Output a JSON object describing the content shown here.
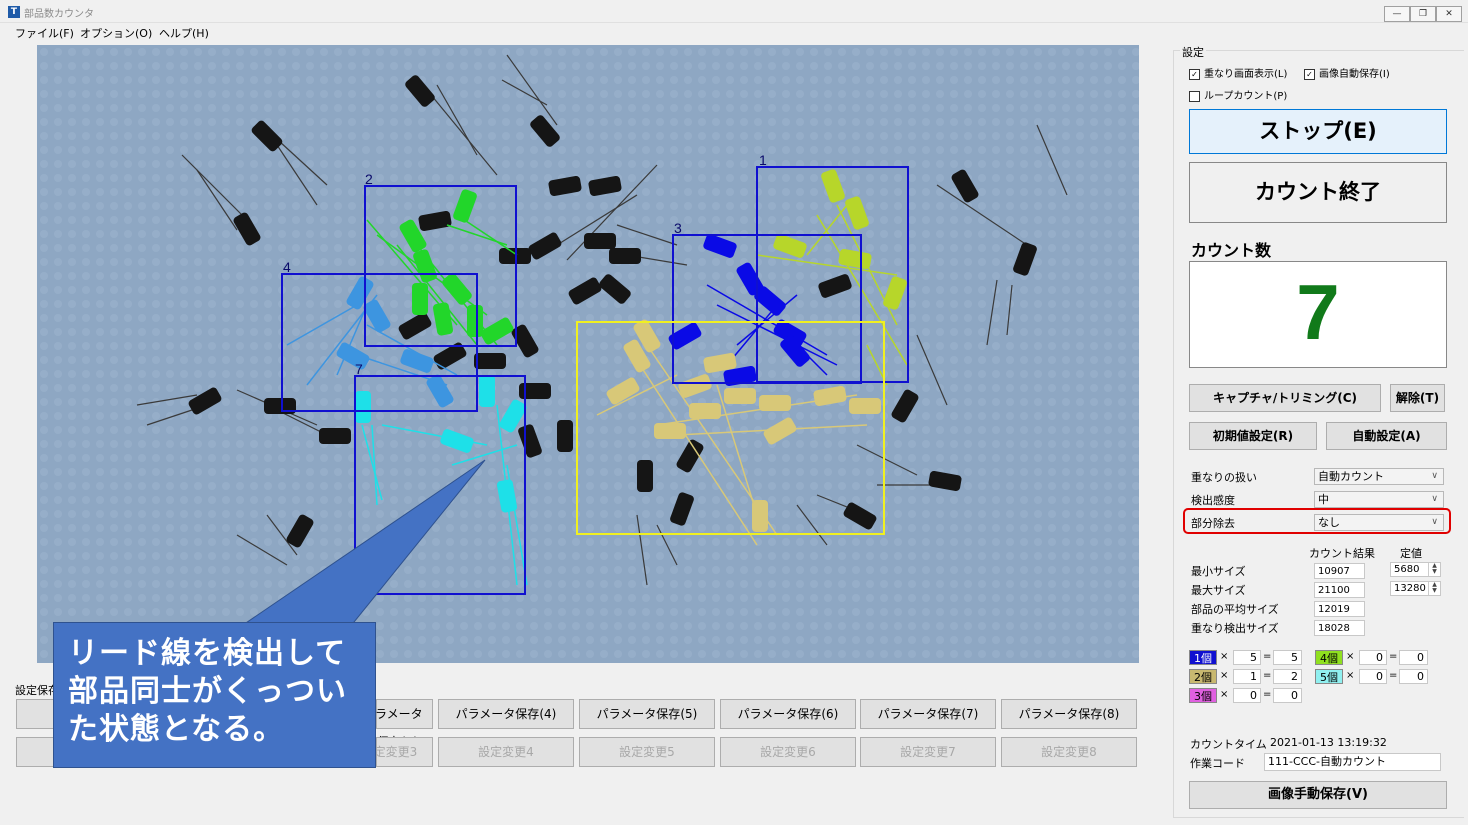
{
  "window": {
    "title": "部品数カウンタ",
    "icon_letter": "T",
    "buttons": [
      "minimize-icon",
      "restore-icon",
      "close-icon"
    ]
  },
  "menu": [
    "ファイル(F)",
    "オプション(O)",
    "ヘルプ(H)"
  ],
  "canvas": {
    "box_labels": [
      "1",
      "2",
      "3",
      "4",
      "7"
    ],
    "box_colors": {
      "1": "#1010d0",
      "2": "#1010d0",
      "3": "#1010d0",
      "4": "#1010d0",
      "7": "#1010d0",
      "yellow": "#f0f020"
    },
    "part_colors": {
      "1": "#b7d62a",
      "2": "#22d62a",
      "3": "#0a0ae6",
      "4": "#3d95e0",
      "5": "#d8c878",
      "7": "#1ee0e8"
    }
  },
  "bottom": {
    "settings_label": "設定保存",
    "save_buttons": [
      "パラメータ保存(3)",
      "パラメータ保存(4)",
      "パラメータ保存(5)",
      "パラメータ保存(6)",
      "パラメータ保存(7)",
      "パラメータ保存(8)"
    ],
    "change_buttons": [
      "設定変更3",
      "設定変更4",
      "設定変更5",
      "設定変更6",
      "設定変更7",
      "設定変更8"
    ]
  },
  "callout": {
    "lines": [
      "リード線を検出して",
      "部品同士がくっつい",
      "た状態となる。"
    ]
  },
  "panel": {
    "group_title": "設定",
    "checks": [
      {
        "label": "重なり画面表示(L)",
        "checked": true
      },
      {
        "label": "画像自動保存(I)",
        "checked": true
      },
      {
        "label": "ループカウント(P)",
        "checked": false
      }
    ],
    "stop_button": "ストップ(E)",
    "end_button": "カウント終了",
    "count_title": "カウント数",
    "count_value": "7",
    "count_color": "#117a1a",
    "capture_button": "キャプチャ/トリミング(C)",
    "release_button": "解除(T)",
    "initial_button": "初期値設定(R)",
    "auto_button": "自動設定(A)",
    "selects": [
      {
        "label": "重なりの扱い",
        "value": "自動カウント"
      },
      {
        "label": "検出感度",
        "value": "中"
      },
      {
        "label": "部分除去",
        "value": "なし"
      }
    ],
    "highlight_color": "#e00000",
    "table": {
      "headers": [
        "カウント結果",
        "定値"
      ],
      "rows": [
        {
          "label": "最小サイズ",
          "result": "10907",
          "set": "5680"
        },
        {
          "label": "最大サイズ",
          "result": "21100",
          "set": "13280"
        },
        {
          "label": "部品の平均サイズ",
          "result": "12019",
          "set": ""
        },
        {
          "label": "重なり検出サイズ",
          "result": "18028",
          "set": ""
        }
      ]
    },
    "multipliers_left": [
      {
        "tag": "1個",
        "color": "#1010d0",
        "text_color": "#ffffff",
        "qty": "5",
        "total": "5"
      },
      {
        "tag": "2個",
        "color": "#c8b870",
        "text_color": "#000000",
        "qty": "1",
        "total": "2"
      },
      {
        "tag": "3個",
        "color": "#e060e0",
        "text_color": "#000000",
        "qty": "0",
        "total": "0"
      }
    ],
    "multipliers_right": [
      {
        "tag": "4個",
        "color": "#90e020",
        "text_color": "#000000",
        "qty": "0",
        "total": "0"
      },
      {
        "tag": "5個",
        "color": "#90f0f0",
        "text_color": "#000000",
        "qty": "0",
        "total": "0"
      }
    ],
    "op_times": "×",
    "op_eq": "=",
    "count_time_label": "カウントタイム",
    "count_time": "2021-01-13 13:19:32",
    "work_code_label": "作業コード",
    "work_code": "111-CCC-自動カウント",
    "manual_save_button": "画像手動保存(V)"
  }
}
